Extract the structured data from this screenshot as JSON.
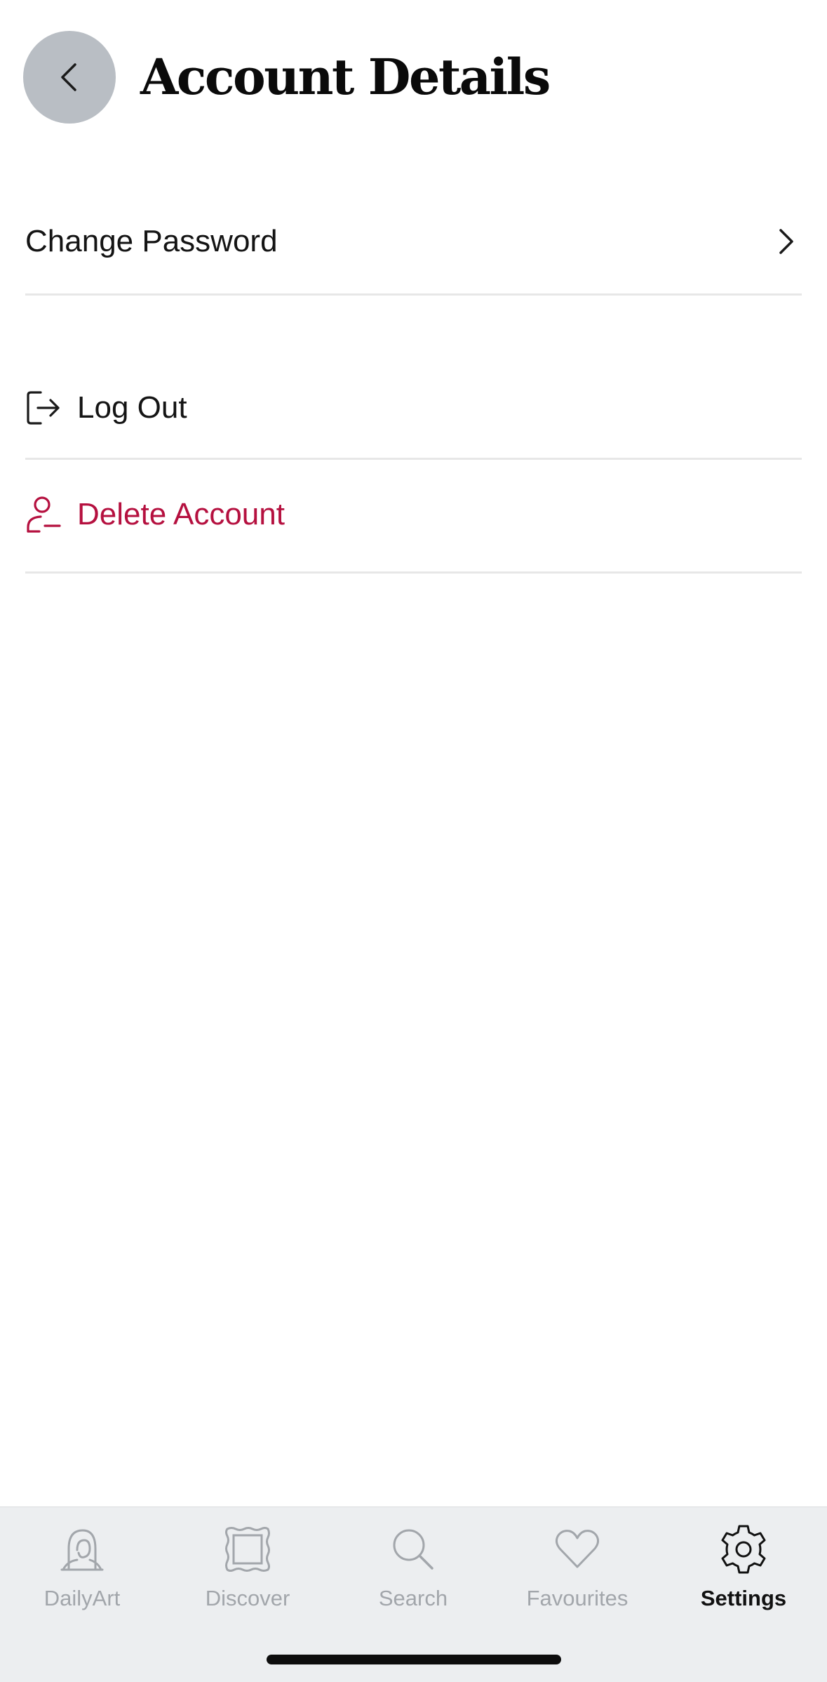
{
  "header": {
    "title": "Account Details",
    "back_icon": "chevron-left-icon"
  },
  "account_rows": {
    "change_password": {
      "label": "Change Password",
      "icon": "chevron-right-icon"
    },
    "log_out": {
      "label": "Log Out",
      "icon": "logout-icon"
    },
    "delete_account": {
      "label": "Delete Account",
      "icon": "remove-user-icon",
      "color": "#b5103f"
    }
  },
  "tab_bar": {
    "active": "Settings",
    "tabs": [
      {
        "label": "DailyArt",
        "icon": "portrait-icon"
      },
      {
        "label": "Discover",
        "icon": "frame-icon"
      },
      {
        "label": "Search",
        "icon": "search-icon"
      },
      {
        "label": "Favourites",
        "icon": "heart-icon"
      },
      {
        "label": "Settings",
        "icon": "gear-icon"
      }
    ]
  },
  "colors": {
    "back_button_bg": "#b9bec4",
    "tab_bar_bg": "#eceef0",
    "inactive_tab": "#a2a6ab",
    "active_tab": "#111111",
    "danger": "#b5103f"
  }
}
